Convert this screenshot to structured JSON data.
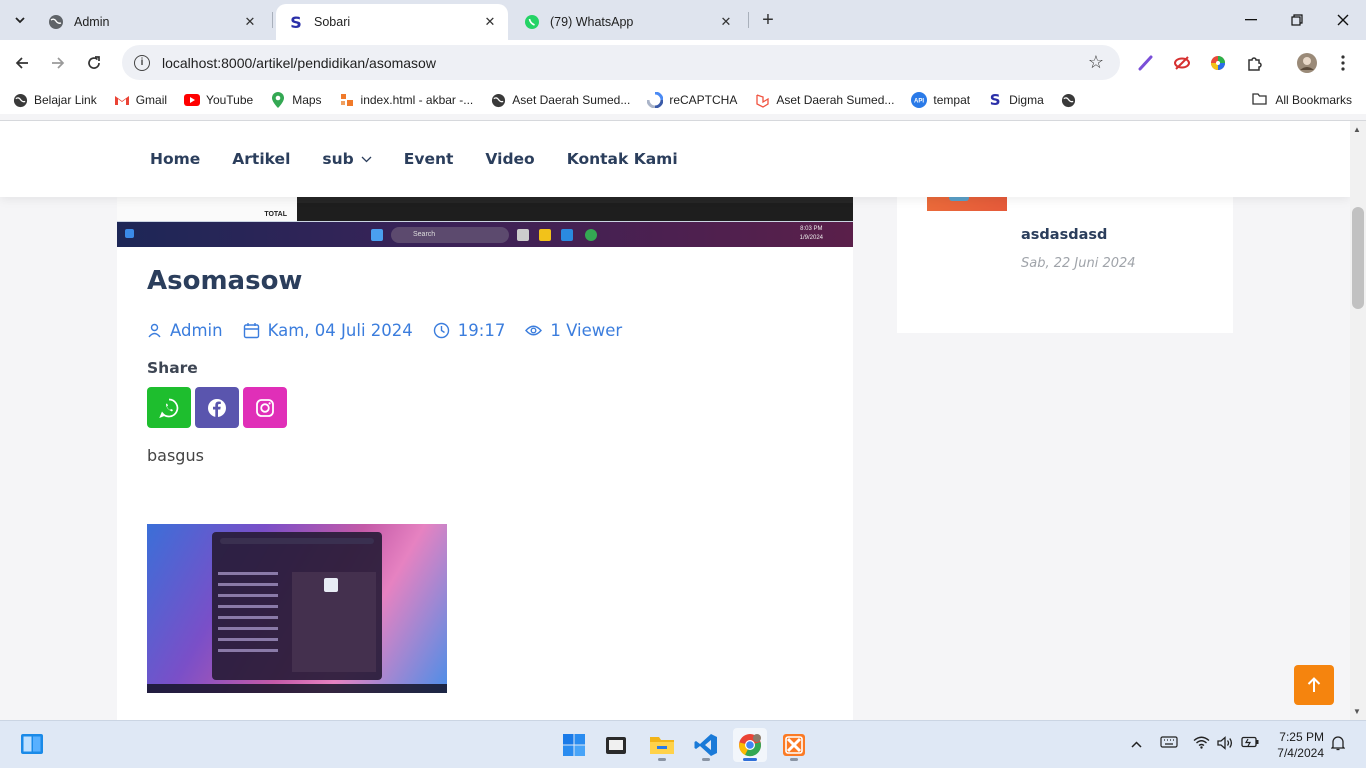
{
  "browser": {
    "tabs": [
      {
        "title": "Admin",
        "favicon": "globe-icon",
        "active": false
      },
      {
        "title": "Sobari",
        "favicon": "sobari-s-icon",
        "active": true
      },
      {
        "title": "(79) WhatsApp",
        "favicon": "whatsapp-icon",
        "active": false
      }
    ],
    "url": "localhost:8000/artikel/pendidikan/asomasow",
    "bookmarks": [
      {
        "label": "Belajar Link",
        "icon": "globe-icon"
      },
      {
        "label": "Gmail",
        "icon": "gmail-icon"
      },
      {
        "label": "YouTube",
        "icon": "youtube-icon"
      },
      {
        "label": "Maps",
        "icon": "maps-icon"
      },
      {
        "label": "index.html - akbar -...",
        "icon": "code-icon"
      },
      {
        "label": "Aset Daerah Sumed...",
        "icon": "globe-icon"
      },
      {
        "label": "reCAPTCHA",
        "icon": "recaptcha-icon"
      },
      {
        "label": "Aset Daerah Sumed...",
        "icon": "laravel-icon"
      },
      {
        "label": "tempat",
        "icon": "api-icon"
      },
      {
        "label": "Digma",
        "icon": "sobari-s-icon"
      },
      {
        "label": "",
        "icon": "globe-icon"
      }
    ],
    "all_bookmarks": "All Bookmarks"
  },
  "site": {
    "nav": {
      "home": "Home",
      "artikel": "Artikel",
      "sub": "sub",
      "event": "Event",
      "video": "Video",
      "kontak": "Kontak Kami"
    },
    "article": {
      "hero": {
        "total_label": "TOTAL",
        "search_label": "Search",
        "time": "8:03 PM",
        "date": "1/9/2024"
      },
      "title": "Asomasow",
      "author": "Admin",
      "date": "Kam, 04 Juli 2024",
      "time": "19:17",
      "views": "1 Viewer",
      "share_label": "Share",
      "body": "basgus"
    },
    "sidebar": {
      "post_title": "asdasdasd",
      "post_date": "Sab, 22 Juni 2024"
    }
  },
  "taskbar": {
    "time": "7:25 PM",
    "date": "7/4/2024"
  },
  "colors": {
    "accent_blue": "#3b7ddd",
    "heading": "#2b3e5c",
    "whatsapp": "#1ebe2e",
    "facebook": "#5a55ae",
    "instagram": "#e02fb8",
    "back_to_top": "#f5840e"
  }
}
